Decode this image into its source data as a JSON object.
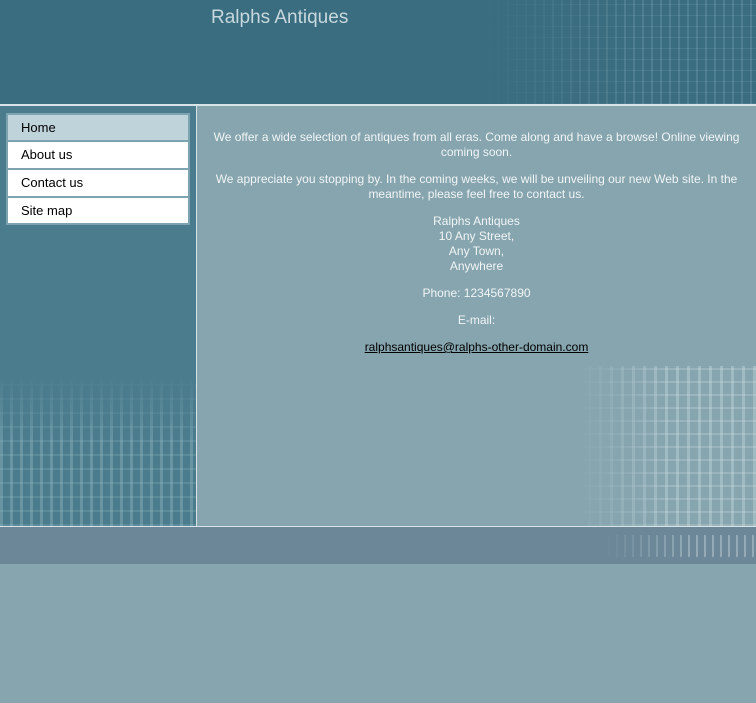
{
  "header": {
    "title": "Ralphs Antiques"
  },
  "nav": {
    "items": [
      {
        "label": "Home",
        "active": true
      },
      {
        "label": "About us"
      },
      {
        "label": "Contact us"
      },
      {
        "label": "Site map"
      }
    ]
  },
  "content": {
    "intro": "We offer a wide selection of antiques from all eras. Come along and have a browse! Online viewing coming soon.",
    "notice": "We appreciate you stopping by. In the coming weeks, we will be unveiling our new Web site. In the meantime, please feel free to contact us.",
    "address": {
      "name": "Ralphs Antiques",
      "line1": "10 Any Street,",
      "line2": "Any Town,",
      "line3": "Anywhere"
    },
    "phone": "Phone: 1234567890",
    "email_label": "E-mail:",
    "email": "ralphsantiques@ralphs-other-domain.com"
  },
  "colors": {
    "header_bg": "#3a6d80",
    "sidebar_bg": "#4a7c8d",
    "content_bg": "#86a5af",
    "footer_bg": "#6b8798",
    "nav_active_bg": "#bfd3da"
  }
}
